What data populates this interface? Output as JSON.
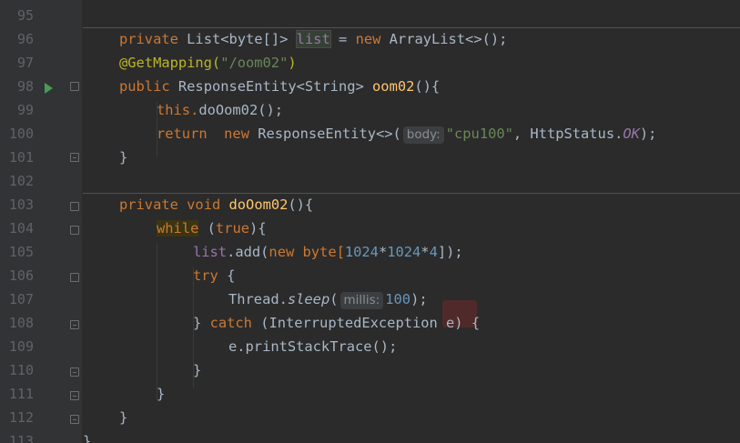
{
  "colors": {
    "background": "#2b2b2b",
    "gutter": "#313335",
    "line_number": "#606366",
    "keyword": "#cc7832",
    "string": "#6a8759",
    "number": "#6897bb",
    "annotation": "#bbb529",
    "method": "#ffc66d",
    "field": "#9876aa",
    "text": "#a9b7c6"
  },
  "lines": [
    {
      "num": "95"
    },
    {
      "num": "96",
      "t1": "private",
      "t2": "List<byte[]>",
      "t3": "list",
      "t4": "=",
      "t5": "new",
      "t6": "ArrayList<>();"
    },
    {
      "num": "97",
      "t1": "@GetMapping(",
      "t2": "\"/oom02\"",
      "t3": ")"
    },
    {
      "num": "98",
      "t1": "public",
      "t2": "ResponseEntity<String>",
      "t3": "oom02",
      "t4": "(){"
    },
    {
      "num": "99",
      "t1": "this.",
      "t2": "doOom02",
      "t3": "();"
    },
    {
      "num": "100",
      "t1": "return",
      "t2": "new",
      "t3": "ResponseEntity<>(",
      "hint": "body:",
      "t4": "\"cpu100\"",
      "t5": ", HttpStatus.",
      "t6": "OK",
      "t7": ");"
    },
    {
      "num": "101",
      "t1": "}"
    },
    {
      "num": "102"
    },
    {
      "num": "103",
      "t1": "private",
      "t2": "void",
      "t3": "doOom02",
      "t4": "(){"
    },
    {
      "num": "104",
      "t1": "while",
      "t2": "(",
      "t3": "true",
      "t4": "){"
    },
    {
      "num": "105",
      "t1": "list",
      "t2": ".add(",
      "t3": "new",
      "t4": "byte[",
      "t5": "1024",
      "t6": "*",
      "t7": "1024",
      "t8": "*",
      "t9": "4",
      "t10": "]);"
    },
    {
      "num": "106",
      "t1": "try",
      "t2": "{"
    },
    {
      "num": "107",
      "t1": "Thread.",
      "t2": "sleep",
      "t3": "(",
      "hint": "millis:",
      "t4": "100",
      "t5": ");"
    },
    {
      "num": "108",
      "t1": "}",
      "t2": "catch",
      "t3": "(InterruptedException e) {"
    },
    {
      "num": "109",
      "t1": "e.printStackTrace",
      "t2": "();"
    },
    {
      "num": "110",
      "t1": "}"
    },
    {
      "num": "111",
      "t1": "}"
    },
    {
      "num": "112",
      "t1": "}"
    },
    {
      "num": "113",
      "t1": "}"
    }
  ]
}
